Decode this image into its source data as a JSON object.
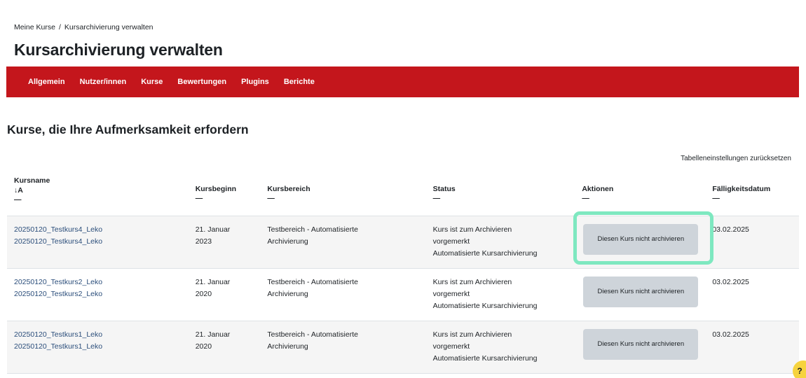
{
  "breadcrumb": {
    "items": [
      "Meine Kurse",
      "Kursarchivierung verwalten"
    ],
    "separator": "/"
  },
  "page_title": "Kursarchivierung verwalten",
  "nav": {
    "items": [
      "Allgemein",
      "Nutzer/innen",
      "Kurse",
      "Bewertungen",
      "Plugins",
      "Berichte"
    ],
    "color": "#c4161c"
  },
  "section_title": "Kurse, die Ihre Aufmerksamkeit erfordern",
  "reset_link": "Tabelleneinstellungen zurücksetzen",
  "table": {
    "headers": {
      "kursname": "Kursname",
      "sort_icon": "↓A",
      "kursbeginn": "Kursbeginn",
      "kursbereich": "Kursbereich",
      "status": "Status",
      "aktionen": "Aktionen",
      "faelligkeit": "Fälligkeitsdatum",
      "dash": "—"
    },
    "rows": [
      {
        "name_line1": "20250120_Testkurs4_Leko",
        "name_line2": "20250120_Testkurs4_Leko",
        "start_line1": "21. Januar",
        "start_line2": "2023",
        "area_line1": "Testbereich - Automatisierte",
        "area_line2": "Archivierung",
        "status_line1": "Kurs ist zum Archivieren",
        "status_line2": "vorgemerkt",
        "status_line3": "Automatisierte Kursarchivierung",
        "action_label": "Diesen Kurs nicht archivieren",
        "due": "03.02.2025"
      },
      {
        "name_line1": "20250120_Testkurs2_Leko",
        "name_line2": "20250120_Testkurs2_Leko",
        "start_line1": "21. Januar",
        "start_line2": "2020",
        "area_line1": "Testbereich - Automatisierte",
        "area_line2": "Archivierung",
        "status_line1": "Kurs ist zum Archivieren",
        "status_line2": "vorgemerkt",
        "status_line3": "Automatisierte Kursarchivierung",
        "action_label": "Diesen Kurs nicht archivieren",
        "due": "03.02.2025"
      },
      {
        "name_line1": "20250120_Testkurs1_Leko",
        "name_line2": "20250120_Testkurs1_Leko",
        "start_line1": "21. Januar",
        "start_line2": "2020",
        "area_line1": "Testbereich - Automatisierte",
        "area_line2": "Archivierung",
        "status_line1": "Kurs ist zum Archivieren",
        "status_line2": "vorgemerkt",
        "status_line3": "Automatisierte Kursarchivierung",
        "action_label": "Diesen Kurs nicht archivieren",
        "due": "03.02.2025"
      }
    ]
  },
  "help_button": "?",
  "colors": {
    "nav": "#c4161c",
    "highlight": "#7ee8c0",
    "button": "#ced4da",
    "help": "#f6d33e"
  }
}
